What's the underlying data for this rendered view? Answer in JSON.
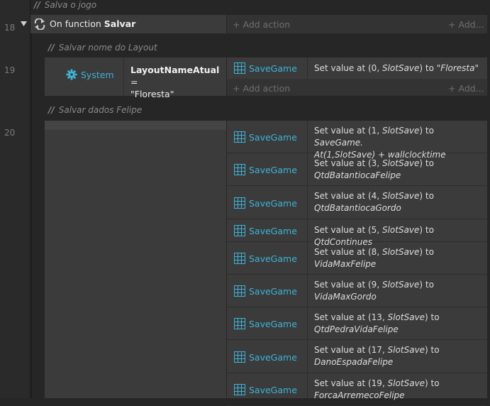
{
  "comments": {
    "top": "Salva o jogo",
    "layout": "Salvar nome do Layout",
    "felipe": "Salvar dados Felipe",
    "slashes": "//"
  },
  "line_numbers": {
    "l18": "18",
    "l19": "19",
    "l20": "20"
  },
  "event18": {
    "prefix": "On function ",
    "name": "Salvar",
    "add_action": "Add action",
    "add_more": "Add..."
  },
  "event19": {
    "condition_object": "System",
    "condition_var": "LayoutNameAtual",
    "condition_op": " =",
    "condition_value": "\"Floresta\"",
    "action_object": "SaveGame",
    "action_text_prefix": "Set value at (",
    "action_index": "0",
    "action_key": "SlotSave",
    "action_text_mid": ") to ",
    "action_value": "\"Floresta\"",
    "add_action": "Add action",
    "add_more": "Add..."
  },
  "event20": {
    "actions": [
      {
        "object": "SaveGame",
        "pre": "Set value at (",
        "idx": "1",
        "key": "SlotSave",
        "mid": ") to ",
        "val": "SaveGame.",
        "line2": "At(1,SlotSave) + wallclocktime"
      },
      {
        "object": "SaveGame",
        "pre": "Set value at (",
        "idx": "3",
        "key": "SlotSave",
        "mid": ") to",
        "val": "",
        "line2": "QtdBatantiocaFelipe"
      },
      {
        "object": "SaveGame",
        "pre": "Set value at (",
        "idx": "4",
        "key": "SlotSave",
        "mid": ") to",
        "val": "",
        "line2": "QtdBatantiocaGordo"
      },
      {
        "object": "SaveGame",
        "pre": "Set value at (",
        "idx": "5",
        "key": "SlotSave",
        "mid": ") to ",
        "val": "QtdContinues",
        "line2": ""
      },
      {
        "object": "SaveGame",
        "pre": "Set value at (",
        "idx": "8",
        "key": "SlotSave",
        "mid": ") to",
        "val": "",
        "line2": "VidaMaxFelipe"
      },
      {
        "object": "SaveGame",
        "pre": "Set value at (",
        "idx": "9",
        "key": "SlotSave",
        "mid": ") to",
        "val": "",
        "line2": "VidaMaxGordo"
      },
      {
        "object": "SaveGame",
        "pre": "Set value at (",
        "idx": "13",
        "key": "SlotSave",
        "mid": ") to",
        "val": "",
        "line2": "QtdPedraVidaFelipe"
      },
      {
        "object": "SaveGame",
        "pre": "Set value at (",
        "idx": "17",
        "key": "SlotSave",
        "mid": ") to",
        "val": "",
        "line2": "DanoEspadaFelipe"
      },
      {
        "object": "SaveGame",
        "pre": "Set value at (",
        "idx": "19",
        "key": "SlotSave",
        "mid": ") to",
        "val": "",
        "line2": "ForcaArremecoFelipe"
      }
    ]
  },
  "colors": {
    "object": "#3db3d8",
    "background": "#262626",
    "panel": "#3b3b3b"
  },
  "icons": {
    "function": "loop-arrows-icon",
    "system": "gear-icon",
    "saveGame": "array-grid-icon",
    "collapse": "triangle-down-icon"
  }
}
